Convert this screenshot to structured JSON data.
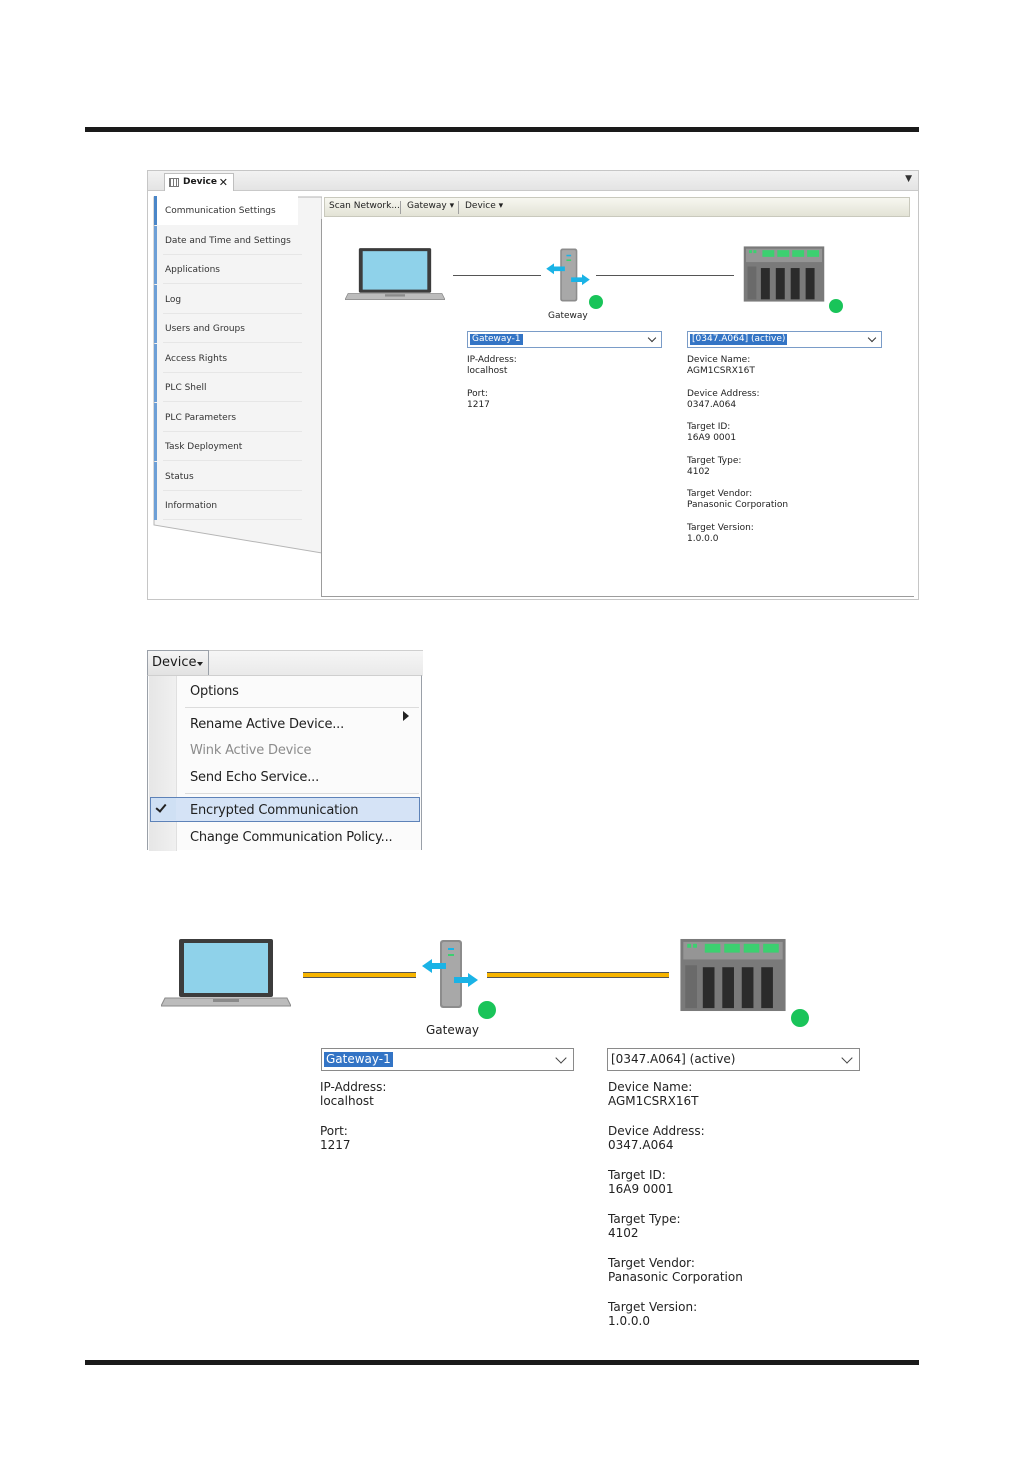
{
  "panel1": {
    "tab_label": "Device",
    "sidebar": [
      "Communication Settings",
      "Date and Time and Settings",
      "Applications",
      "Log",
      "Users and Groups",
      "Access Rights",
      "PLC Shell",
      "PLC Parameters",
      "Task Deployment",
      "Status",
      "Information"
    ],
    "toolbar": {
      "scan_network": "Scan Network...",
      "gateway": "Gateway",
      "device": "Device"
    },
    "gateway_label": "Gateway",
    "gateway_select": "Gateway-1",
    "device_select": "[0347.A064] (active)",
    "gateway_info": [
      {
        "label": "IP-Address:",
        "value": "localhost"
      },
      {
        "label": "Port:",
        "value": "1217"
      }
    ],
    "device_info": [
      {
        "label": "Device Name:",
        "value": "AGM1CSRX16T"
      },
      {
        "label": "Device Address:",
        "value": "0347.A064"
      },
      {
        "label": "Target ID:",
        "value": "16A9 0001"
      },
      {
        "label": "Target Type:",
        "value": "4102"
      },
      {
        "label": "Target Vendor:",
        "value": "Panasonic Corporation"
      },
      {
        "label": "Target Version:",
        "value": "1.0.0.0"
      }
    ]
  },
  "panel2": {
    "menu_button": "Device",
    "items": {
      "options": "Options",
      "rename": "Rename Active Device...",
      "wink": "Wink Active Device",
      "echo": "Send Echo Service...",
      "encrypted": "Encrypted Communication",
      "policy": "Change Communication Policy..."
    }
  },
  "panel3": {
    "gateway_label": "Gateway",
    "gateway_select": "Gateway-1",
    "device_select": "[0347.A064] (active)",
    "gateway_info": [
      {
        "label": "IP-Address:",
        "value": "localhost"
      },
      {
        "label": "Port:",
        "value": "1217"
      }
    ],
    "device_info": [
      {
        "label": "Device Name:",
        "value": "AGM1CSRX16T"
      },
      {
        "label": "Device Address:",
        "value": "0347.A064"
      },
      {
        "label": "Target ID:",
        "value": "16A9 0001"
      },
      {
        "label": "Target Type:",
        "value": "4102"
      },
      {
        "label": "Target Vendor:",
        "value": "Panasonic Corporation"
      },
      {
        "label": "Target Version:",
        "value": "1.0.0.0"
      }
    ],
    "encrypted_line_color": "#f6b400"
  },
  "colors": {
    "status_ok": "#19c459",
    "selection": "#3374c5",
    "gateway_arrows": "#1ab3e6",
    "accent": "#4a86c8"
  }
}
